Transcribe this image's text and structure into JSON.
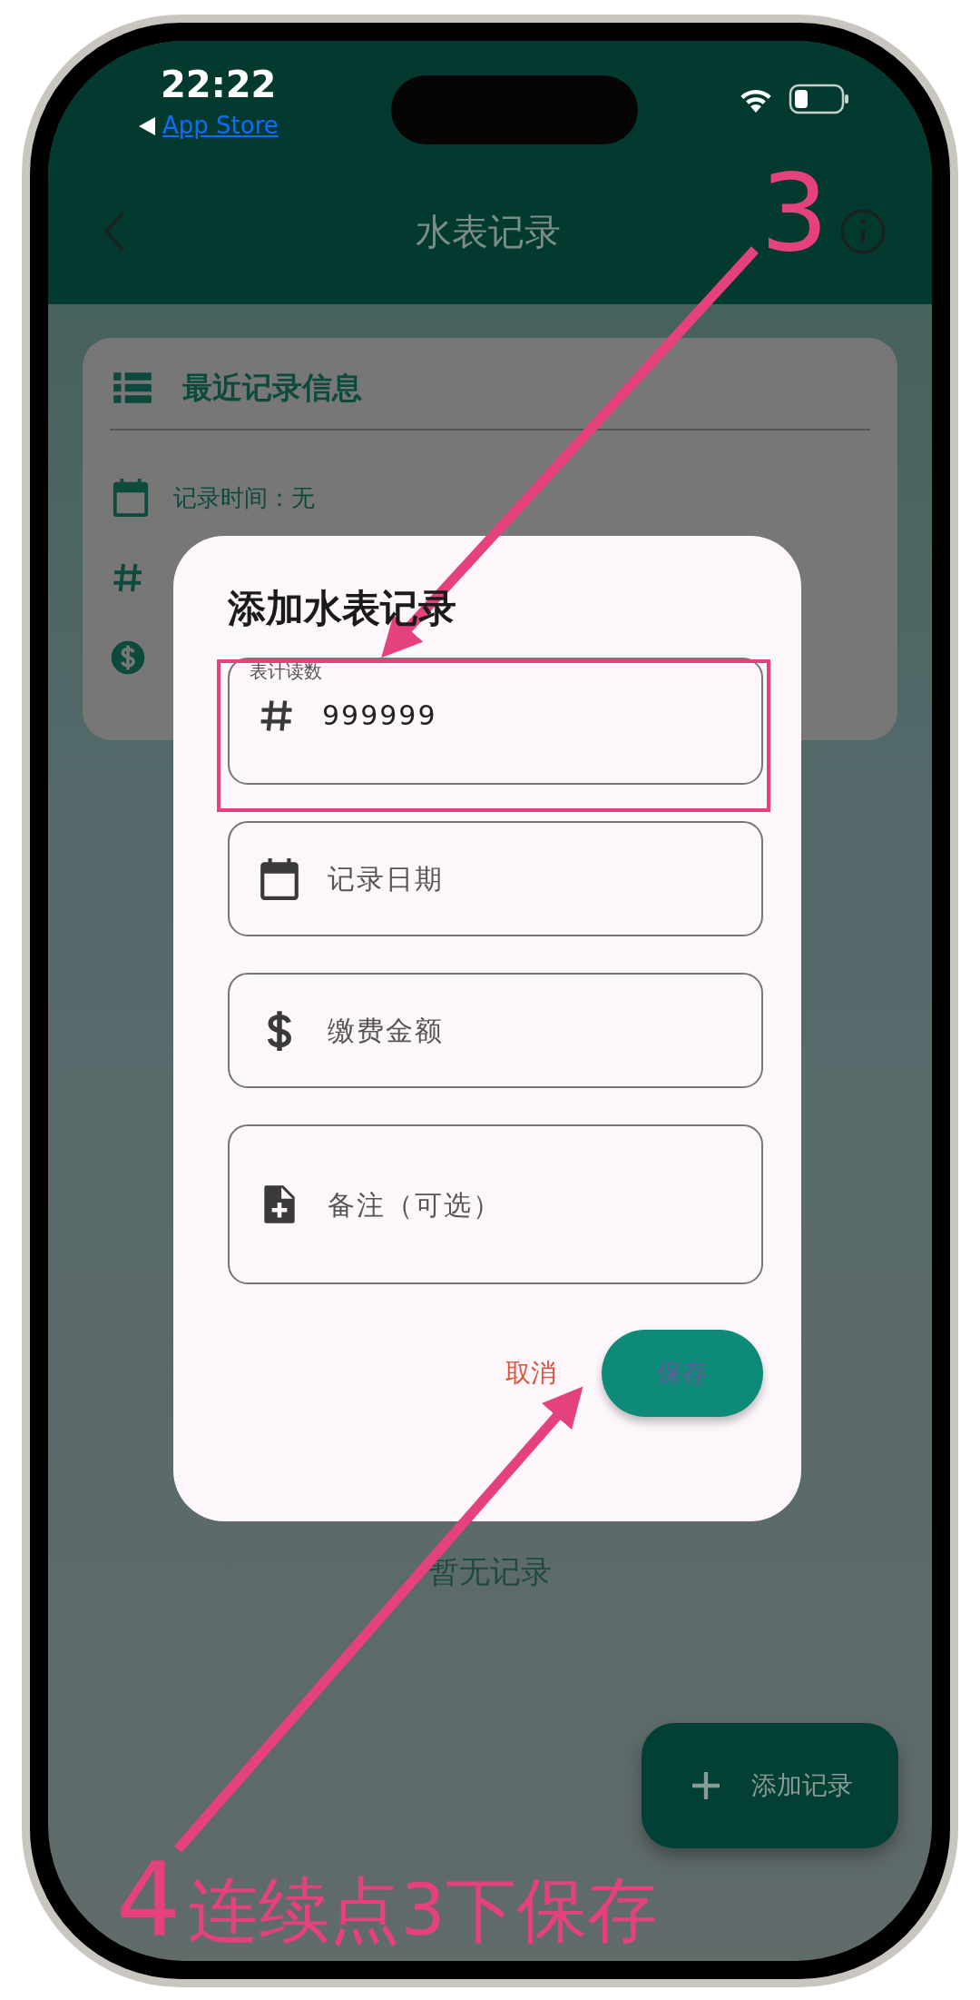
{
  "status_bar": {
    "time": "22:22",
    "back_link": "App Store"
  },
  "app_bar": {
    "title": "水表记录"
  },
  "summary_card": {
    "title": "最近记录信息",
    "rows": [
      {
        "kind": "date",
        "text": "记录时间：无"
      },
      {
        "kind": "reading"
      },
      {
        "kind": "amount"
      }
    ]
  },
  "empty_text": "暂无记录",
  "fab": {
    "label": "添加记录"
  },
  "dialog": {
    "title": "添加水表记录",
    "fields": [
      {
        "kind": "reading",
        "label": "表计读数",
        "value": "999999"
      },
      {
        "kind": "date",
        "placeholder": "记录日期"
      },
      {
        "kind": "amount",
        "placeholder": "缴费金额"
      },
      {
        "kind": "note",
        "placeholder": "备注（可选）"
      }
    ],
    "buttons": [
      {
        "kind": "text",
        "label": "取消"
      },
      {
        "kind": "filled",
        "label": "保存"
      }
    ]
  },
  "annotations": [
    {
      "kind": "callout",
      "number": "3"
    },
    {
      "kind": "caption",
      "number": "4",
      "text": "连续点3下保存"
    }
  ]
}
